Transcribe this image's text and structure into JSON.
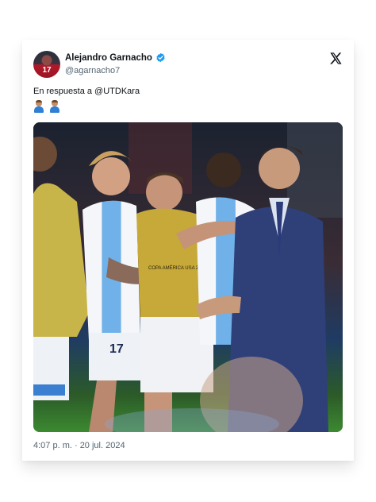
{
  "tweet": {
    "author_name": "Alejandro Garnacho",
    "author_handle": "@agarnacho7",
    "avatar_number": "17",
    "reply_text": "En respuesta a @UTDKara",
    "emojis": [
      "man-facepalming-emoji",
      "man-facepalming-emoji"
    ],
    "timestamp": "4:07 p. m. · 20 jul. 2024",
    "photo_shirt_number": "17",
    "photo_vest_text": "COPA AMÉRICA USA 2024"
  },
  "icons": {
    "verified": "verified-badge-icon",
    "brand": "x-logo-icon"
  },
  "colors": {
    "verified_blue": "#1d9bf0",
    "text_primary": "#0f1419",
    "text_secondary": "#536471"
  }
}
